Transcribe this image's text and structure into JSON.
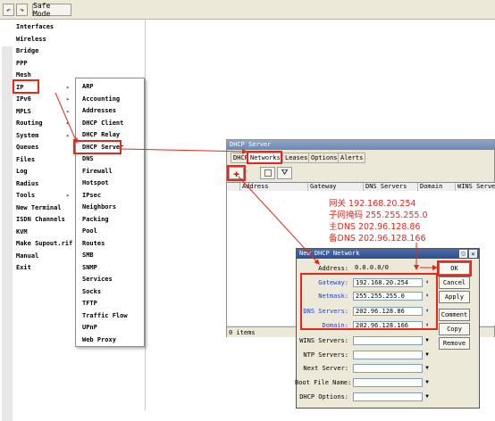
{
  "toolbar": {
    "safe_mode_label": "Safe Mode",
    "undo_icon": "undo-icon",
    "redo_icon": "redo-icon"
  },
  "sidebar": {
    "items": [
      {
        "label": "Interfaces"
      },
      {
        "label": "Wireless"
      },
      {
        "label": "Bridge"
      },
      {
        "label": "PPP"
      },
      {
        "label": "Mesh"
      },
      {
        "label": "IP",
        "arrow": "▸"
      },
      {
        "label": "IPv6",
        "arrow": "▸"
      },
      {
        "label": "MPLS",
        "arrow": "▸"
      },
      {
        "label": "Routing",
        "arrow": "▸"
      },
      {
        "label": "System",
        "arrow": "▸"
      },
      {
        "label": "Queues"
      },
      {
        "label": "Files"
      },
      {
        "label": "Log"
      },
      {
        "label": "Radius"
      },
      {
        "label": "Tools",
        "arrow": "▸"
      },
      {
        "label": "New Terminal"
      },
      {
        "label": "ISDN Channels"
      },
      {
        "label": "KVM"
      },
      {
        "label": "Make Supout.rif"
      },
      {
        "label": "Manual"
      },
      {
        "label": "Exit"
      }
    ]
  },
  "ip_submenu": {
    "items": [
      "ARP",
      "Accounting",
      "Addresses",
      "DHCP Client",
      "DHCP Relay",
      "DHCP Server",
      "DNS",
      "Firewall",
      "Hotspot",
      "IPsec",
      "Neighbors",
      "Packing",
      "Pool",
      "Routes",
      "SMB",
      "SNMP",
      "Services",
      "Socks",
      "TFTP",
      "Traffic Flow",
      "UPnP",
      "Web Proxy"
    ]
  },
  "dhcp_window": {
    "title": "DHCP Server",
    "tabs": [
      "DHCP",
      "Networks",
      "Leases",
      "Options",
      "Alerts"
    ],
    "columns": [
      "Address",
      "Gateway",
      "DNS Servers",
      "Domain",
      "WINS Server"
    ],
    "status": "0 items"
  },
  "annotation": {
    "lines": [
      "网关 192.168.20.254",
      "子网掩码 255.255.255.0",
      "主DNS 202.96.128.86",
      "备DNS 202.96.128.166"
    ]
  },
  "new_network": {
    "title": "New DHCP Network",
    "fields": {
      "address": {
        "label": "Address:",
        "value": "0.0.0.0/0"
      },
      "gateway": {
        "label": "Gateway:",
        "value": "192.168.20.254"
      },
      "netmask": {
        "label": "Netmask:",
        "value": "255.255.255.0"
      },
      "dns1": {
        "label": "DNS Servers:",
        "value": "202.96.128.86"
      },
      "domain": {
        "label": "Domain:",
        "value": "202.96.128.166"
      },
      "wins": {
        "label": "WINS Servers:",
        "value": ""
      },
      "ntp": {
        "label": "NTP Servers:",
        "value": ""
      },
      "next_server": {
        "label": "Next Server:",
        "value": ""
      },
      "boot_file": {
        "label": "Boot File Name:",
        "value": ""
      },
      "dhcp_options": {
        "label": "DHCP Options:",
        "value": ""
      }
    },
    "buttons": {
      "ok": "OK",
      "cancel": "Cancel",
      "apply": "Apply",
      "comment": "Comment",
      "copy": "Copy",
      "remove": "Remove"
    }
  },
  "colors": {
    "highlight_red": "#e8261a",
    "field_label_blue": "#1f3fd8"
  }
}
